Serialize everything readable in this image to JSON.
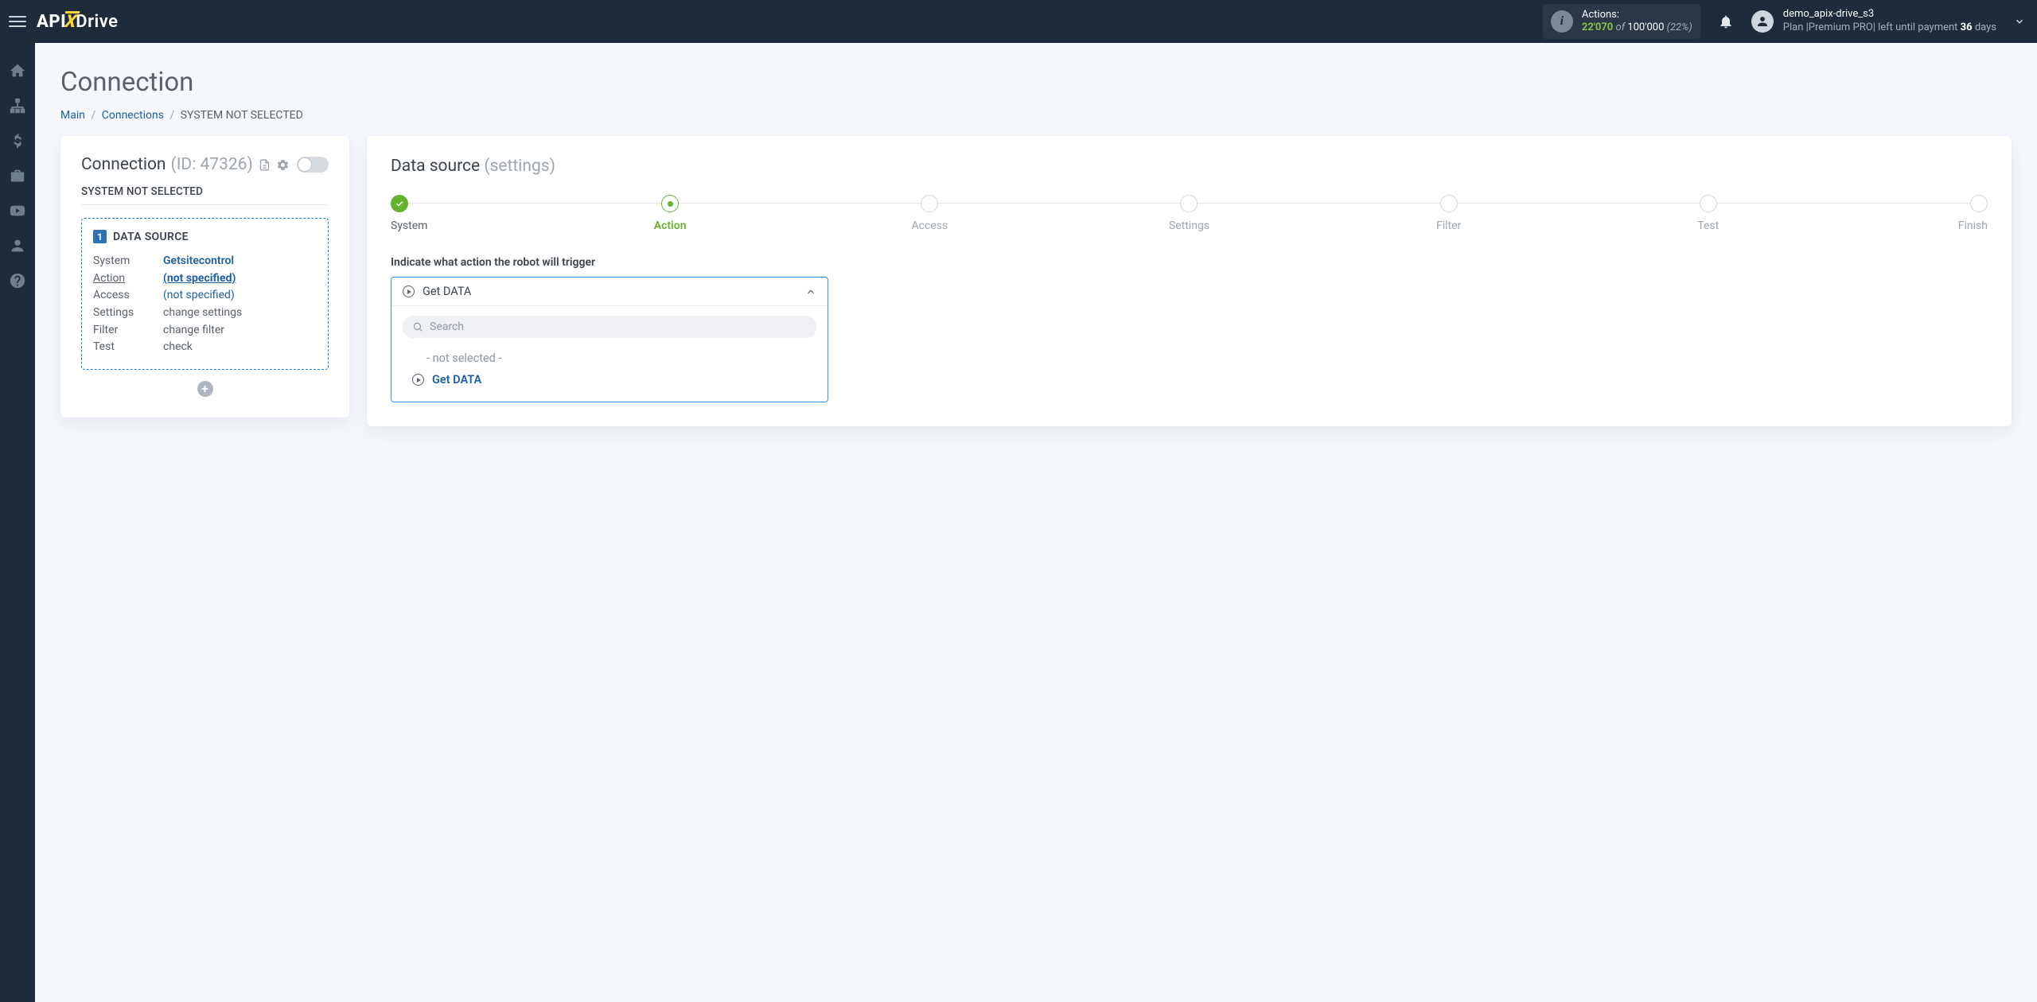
{
  "topbar": {
    "logo": {
      "api": "API",
      "x": "X",
      "drive": "Drive"
    },
    "actions": {
      "label": "Actions:",
      "used": "22'070",
      "of": "of",
      "total": "100'000",
      "pct": "(22%)"
    },
    "profile": {
      "username": "demo_apix-drive_s3",
      "plan_prefix": "Plan |",
      "plan_name": "Premium PRO",
      "plan_mid": "| left until payment",
      "days": "36",
      "days_suffix": "days"
    }
  },
  "page": {
    "title": "Connection",
    "breadcrumb": {
      "main": "Main",
      "connections": "Connections",
      "current": "SYSTEM NOT SELECTED"
    }
  },
  "left": {
    "title": "Connection",
    "id": "(ID: 47326)",
    "system_label": "SYSTEM NOT SELECTED",
    "ds": {
      "num": "1",
      "title": "DATA SOURCE",
      "rows": {
        "system": {
          "k": "System",
          "v": "Getsitecontrol"
        },
        "action": {
          "k": "Action",
          "v": "(not specified)"
        },
        "access": {
          "k": "Access",
          "v": "(not specified)"
        },
        "settings": {
          "k": "Settings",
          "v": "change settings"
        },
        "filter": {
          "k": "Filter",
          "v": "change filter"
        },
        "test": {
          "k": "Test",
          "v": "check"
        }
      }
    }
  },
  "right": {
    "title": "Data source",
    "subtitle": "(settings)",
    "steps": [
      "System",
      "Action",
      "Access",
      "Settings",
      "Filter",
      "Test",
      "Finish"
    ],
    "field_label": "Indicate what action the robot will trigger",
    "select": {
      "current": "Get DATA",
      "search_ph": "Search",
      "opt_not_selected": "- not selected -",
      "opt_get_data": "Get DATA"
    }
  }
}
